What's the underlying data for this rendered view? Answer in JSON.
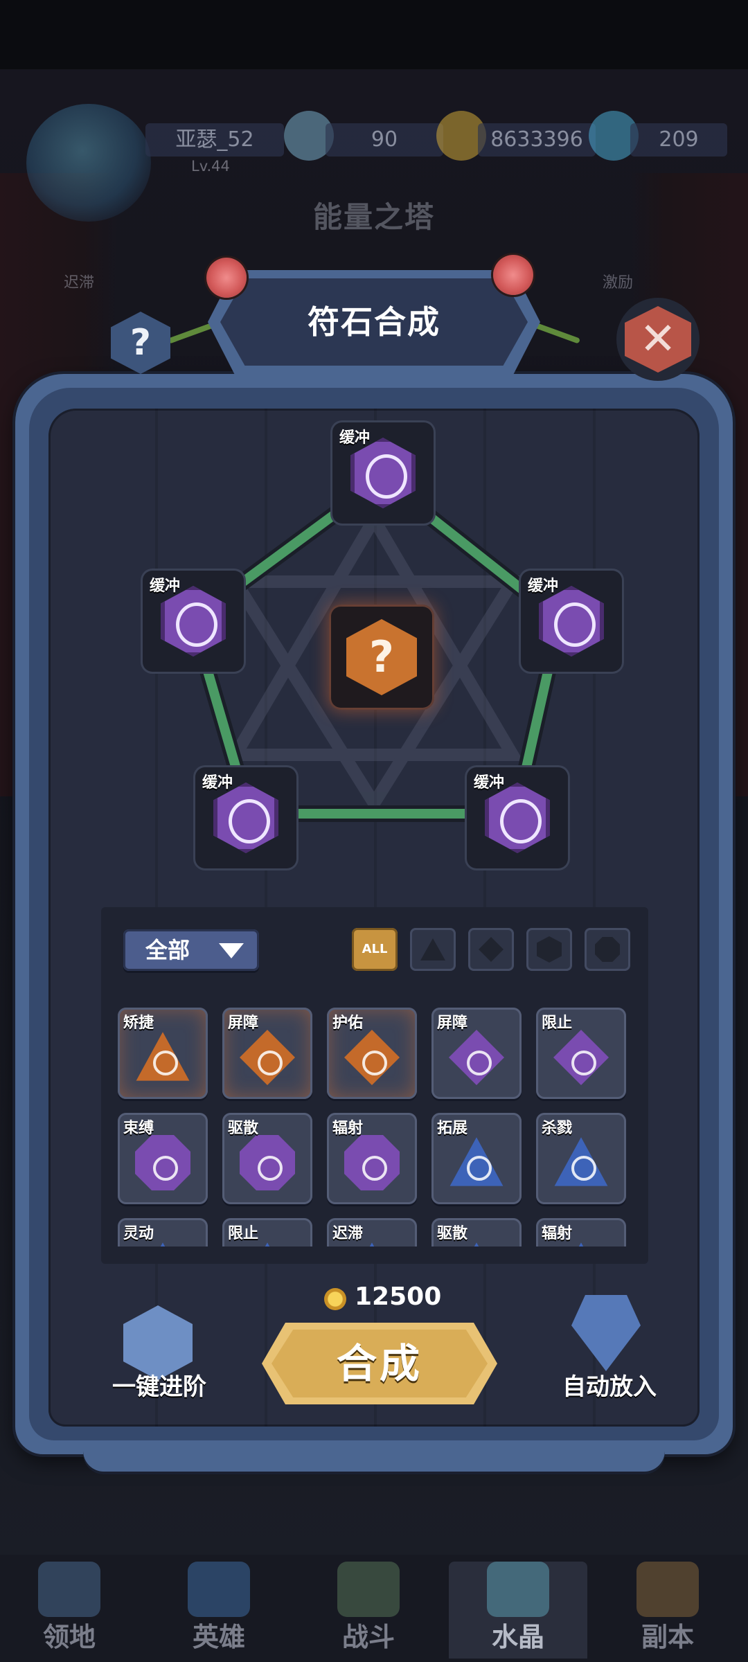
{
  "player": {
    "name": "亚瑟_52",
    "level": "Lv.44"
  },
  "resources": {
    "stamina": "90",
    "gold": "8633396",
    "diamond": "209"
  },
  "background": {
    "tower_title": "能量之塔",
    "left_label": "迟滞",
    "right_label": "激励"
  },
  "dialog": {
    "title": "符石合成",
    "close_symbol": "✕",
    "help_symbol": "?"
  },
  "synthesis": {
    "center_symbol": "?",
    "slots": [
      {
        "label": "缓冲"
      },
      {
        "label": "缓冲"
      },
      {
        "label": "缓冲"
      },
      {
        "label": "缓冲"
      },
      {
        "label": "缓冲"
      }
    ]
  },
  "filter": {
    "dropdown_label": "全部",
    "tabs": [
      {
        "label": "ALL",
        "active": true,
        "shape": "all"
      },
      {
        "label": "",
        "active": false,
        "shape": "triangle"
      },
      {
        "label": "",
        "active": false,
        "shape": "diamond"
      },
      {
        "label": "",
        "active": false,
        "shape": "hexagon"
      },
      {
        "label": "",
        "active": false,
        "shape": "octagon"
      }
    ]
  },
  "runes": [
    {
      "name": "矫捷",
      "shape": "tri",
      "color": "#c46a2a",
      "glow": true
    },
    {
      "name": "屏障",
      "shape": "dia",
      "color": "#c46a2a",
      "glow": true
    },
    {
      "name": "护佑",
      "shape": "dia",
      "color": "#c46a2a",
      "glow": true
    },
    {
      "name": "屏障",
      "shape": "dia",
      "color": "#7a4cb0",
      "glow": false
    },
    {
      "name": "限止",
      "shape": "dia",
      "color": "#7a4cb0",
      "glow": false
    },
    {
      "name": "束缚",
      "shape": "oct",
      "color": "#7a4cb0",
      "glow": false
    },
    {
      "name": "驱散",
      "shape": "oct",
      "color": "#7a4cb0",
      "glow": false
    },
    {
      "name": "辐射",
      "shape": "oct",
      "color": "#7a4cb0",
      "glow": false
    },
    {
      "name": "拓展",
      "shape": "tri",
      "color": "#3d63b8",
      "glow": false
    },
    {
      "name": "杀戮",
      "shape": "tri",
      "color": "#3d63b8",
      "glow": false
    },
    {
      "name": "灵动",
      "shape": "tri",
      "color": "#3d63b8",
      "glow": false
    },
    {
      "name": "限止",
      "shape": "tri",
      "color": "#3d63b8",
      "glow": false
    },
    {
      "name": "迟滞",
      "shape": "tri",
      "color": "#3d63b8",
      "glow": false
    },
    {
      "name": "驱散",
      "shape": "tri",
      "color": "#3d63b8",
      "glow": false
    },
    {
      "name": "辐射",
      "shape": "tri",
      "color": "#3d63b8",
      "glow": false
    }
  ],
  "actions": {
    "cost": "12500",
    "synthesize_label": "合成",
    "auto_upgrade_label": "一键进阶",
    "auto_put_label": "自动放入"
  },
  "nav": [
    {
      "label": "领地",
      "icon": "territory-icon",
      "active": false
    },
    {
      "label": "英雄",
      "icon": "hero-icon",
      "active": false
    },
    {
      "label": "战斗",
      "icon": "battle-icon",
      "active": false
    },
    {
      "label": "水晶",
      "icon": "crystal-icon",
      "active": true
    },
    {
      "label": "副本",
      "icon": "dungeon-icon",
      "active": false
    }
  ],
  "colors": {
    "frame": "#4b6691",
    "panel": "#272c3e",
    "link_line": "#4a9a64",
    "gold_button": "#d9ad57",
    "close_button": "#b85548"
  }
}
